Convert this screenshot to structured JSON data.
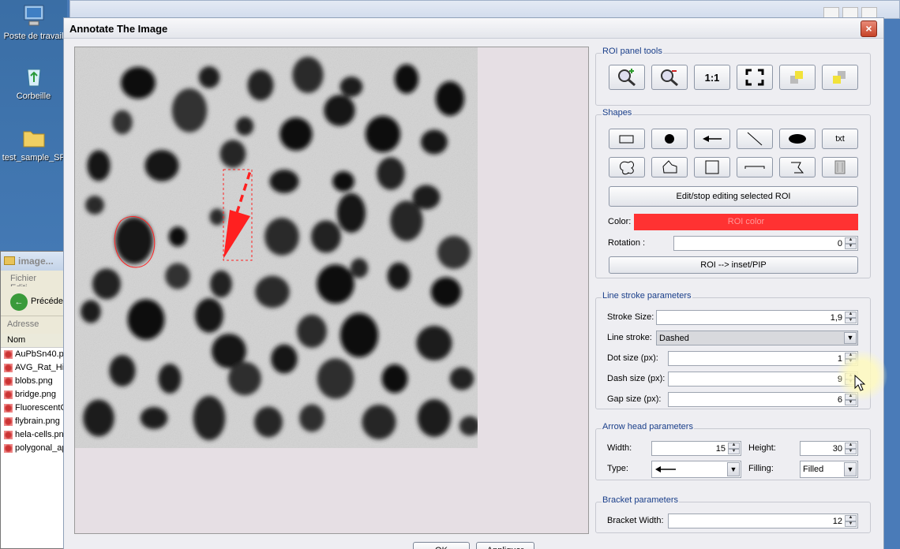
{
  "desktop": {
    "icons": [
      {
        "label": "Poste de travail",
        "icon": "computer-icon"
      },
      {
        "label": "Corbeille",
        "icon": "recycle-bin-icon"
      },
      {
        "label": "test_sample_SF",
        "icon": "folder-icon"
      }
    ]
  },
  "explorer": {
    "title": "image...",
    "menu": [
      "Fichier",
      "Editi"
    ],
    "back_label": "Précéde",
    "address_label": "Adresse",
    "column": "Nom",
    "files": [
      "AuPbSn40.pn",
      "AVG_Rat_Hip",
      "blobs.png",
      "bridge.png",
      "FluorescentC",
      "flybrain.png",
      "hela-cells.pn",
      "polygonal_ap"
    ]
  },
  "dialog": {
    "title": "Annotate The Image",
    "close": "×",
    "roi_tools": {
      "title": "ROI panel tools",
      "buttons": [
        {
          "name": "zoom-in",
          "icon": "zoom-in-icon"
        },
        {
          "name": "zoom-out",
          "icon": "zoom-out-icon"
        },
        {
          "name": "actual-size",
          "label": "1:1"
        },
        {
          "name": "fit",
          "icon": "fullscreen-icon"
        },
        {
          "name": "send-back",
          "icon": "layer-back-icon"
        },
        {
          "name": "bring-front",
          "icon": "layer-front-icon"
        }
      ]
    },
    "shapes": {
      "title": "Shapes",
      "text_tool": "txt",
      "edit_button": "Edit/stop editing selected ROI",
      "color_label": "Color:",
      "color_text": "ROI color",
      "color_value": "#ff3232",
      "rotation_label": "Rotation :",
      "rotation_value": "0",
      "inset_button": "ROI --> inset/PIP"
    },
    "line_stroke": {
      "title": "Line stroke parameters",
      "stroke_size_label": "Stroke Size:",
      "stroke_size": "1,9",
      "line_stroke_label": "Line stroke:",
      "line_stroke_value": "Dashed",
      "dot_size_label": "Dot size (px):",
      "dot_size": "1",
      "dash_size_label": "Dash size (px):",
      "dash_size": "9",
      "gap_size_label": "Gap size (px):",
      "gap_size": "6"
    },
    "arrow_head": {
      "title": "Arrow head parameters",
      "width_label": "Width:",
      "width": "15",
      "height_label": "Height:",
      "height": "30",
      "type_label": "Type:",
      "filling_label": "Filling:",
      "filling_value": "Filled"
    },
    "bracket": {
      "title": "Bracket parameters",
      "width_label": "Bracket Width:",
      "width": "12"
    },
    "footer": {
      "ok": "OK",
      "apply": "Appliquer"
    }
  }
}
